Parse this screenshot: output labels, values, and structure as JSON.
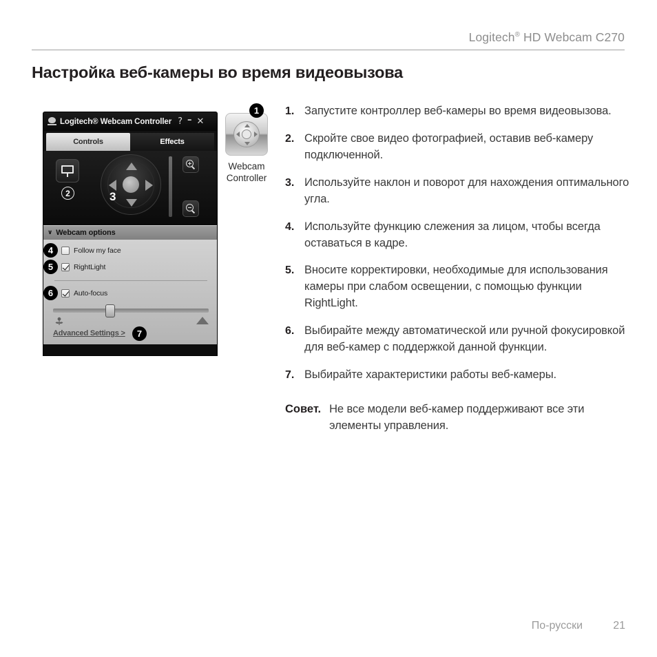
{
  "header": {
    "product_title": "Logitech",
    "product_title_sup": "®",
    "product_title_rest": " HD Webcam C270"
  },
  "page_title": "Настройка веб-камеры во время видеовызова",
  "controller_window": {
    "title": "Logitech® Webcam Controller",
    "titlebar_buttons": {
      "help": "?",
      "minimize": "–",
      "close": "✕"
    },
    "tabs": [
      {
        "label": "Controls",
        "active": true
      },
      {
        "label": "Effects",
        "active": false
      }
    ],
    "options_section_title": "Webcam options",
    "options_chevron": "∨",
    "options": [
      {
        "label": "Follow my face",
        "checked": false,
        "callout": "4"
      },
      {
        "label": "RightLight",
        "checked": true,
        "callout": "5"
      },
      {
        "label": "Auto-focus",
        "checked": true,
        "callout": "6"
      }
    ],
    "advanced_settings_link": "Advanced Settings >",
    "callouts": {
      "hide_video": "2",
      "dpad": "3",
      "advanced_settings": "7"
    }
  },
  "webcam_icon": {
    "callout": "1",
    "label_line1": "Webcam",
    "label_line2": "Controller"
  },
  "instructions": {
    "steps": [
      {
        "num": "1.",
        "text": "Запустите контроллер веб-камеры во время видеовызова."
      },
      {
        "num": "2.",
        "text": "Скройте свое видео фотографией, оставив веб-камеру подключенной."
      },
      {
        "num": "3.",
        "text": "Используйте наклон и поворот для нахождения оптимального угла."
      },
      {
        "num": "4.",
        "text": "Используйте функцию слежения за лицом, чтобы всегда оставаться в кадре."
      },
      {
        "num": "5.",
        "text": "Вносите корректировки, необходимые для использования камеры при слабом освещении, с помощью функции RightLight."
      },
      {
        "num": "6.",
        "text": "Выбирайте между автоматической или ручной фокусировкой для веб-камер с поддержкой данной функции."
      },
      {
        "num": "7.",
        "text": "Выбирайте характеристики работы веб-камеры."
      }
    ],
    "tip_label": "Совет.",
    "tip_text": "Не все модели веб-камер поддерживают все эти элементы управления."
  },
  "footer": {
    "language": "По-русски",
    "page_number": "21"
  },
  "colors": {
    "text": "#3a3a3a",
    "heading": "#231f20",
    "muted": "#9b9b9b",
    "rule": "#a0a0a0"
  }
}
